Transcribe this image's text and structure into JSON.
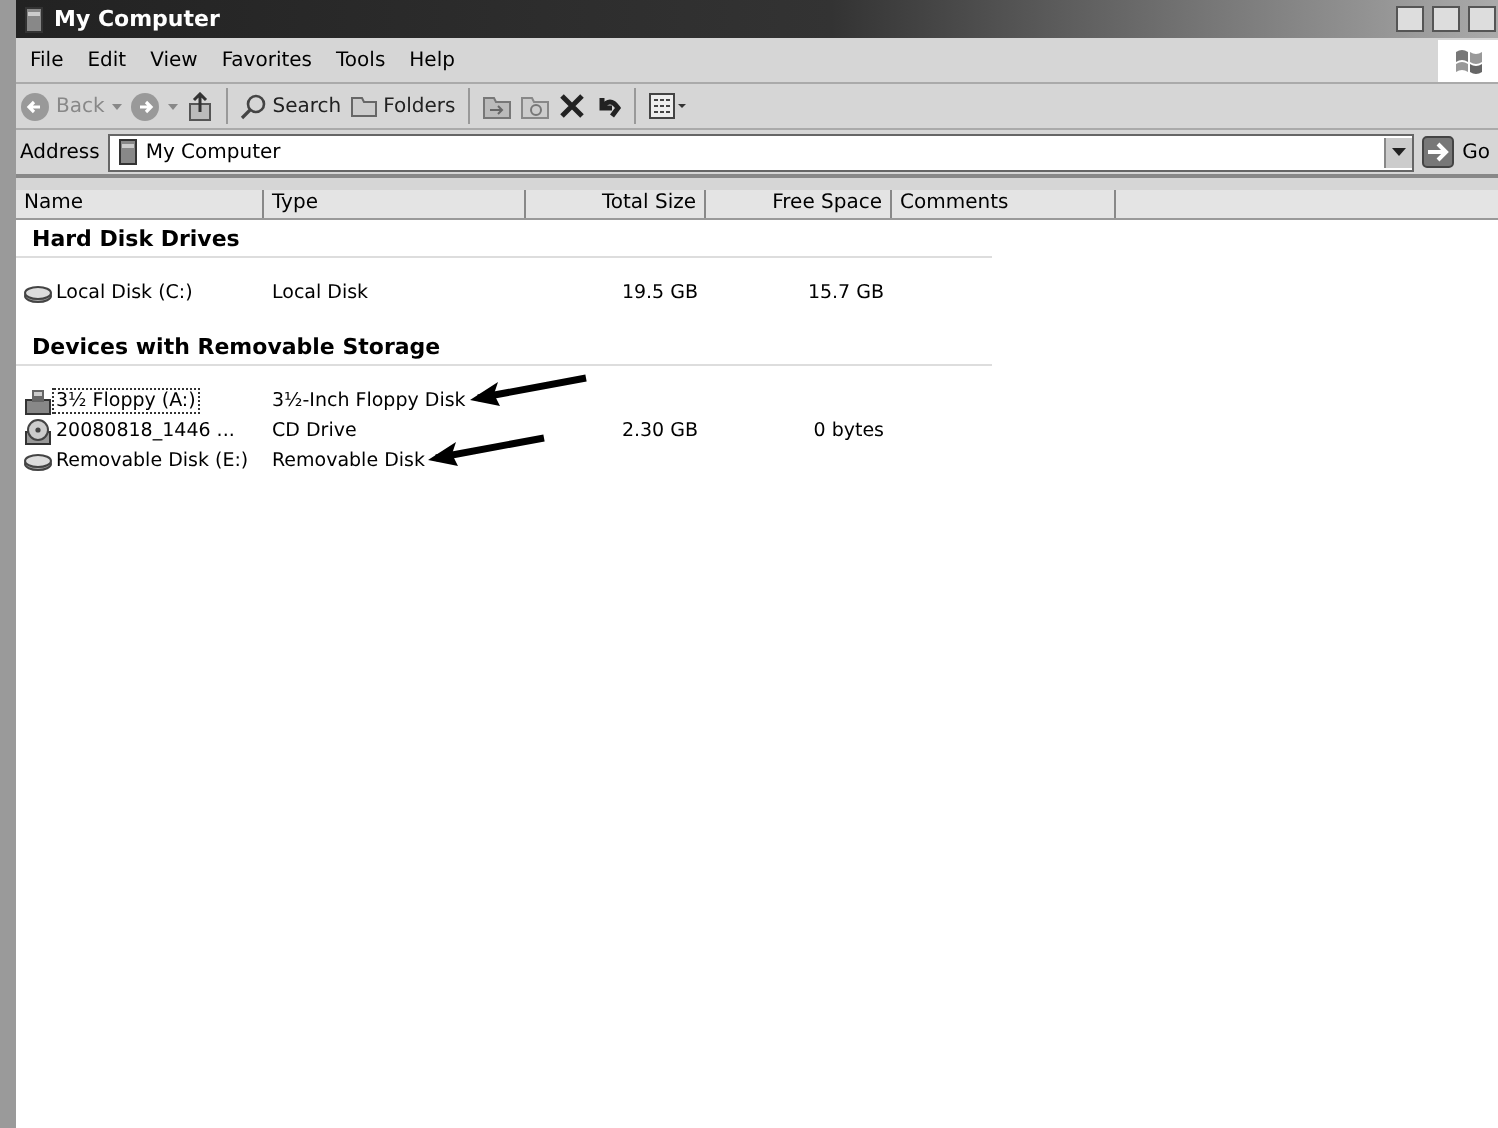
{
  "window": {
    "title": "My Computer"
  },
  "menu": [
    "File",
    "Edit",
    "View",
    "Favorites",
    "Tools",
    "Help"
  ],
  "toolbar": {
    "back": "Back",
    "search": "Search",
    "folders": "Folders"
  },
  "address": {
    "label": "Address",
    "value": "My Computer",
    "go": "Go"
  },
  "table": {
    "columns": [
      "Name",
      "Type",
      "Total Size",
      "Free Space",
      "Comments"
    ],
    "groups": [
      {
        "title": "Hard Disk Drives",
        "rows": [
          {
            "kind": "harddisk",
            "name": "Local Disk (C:)",
            "type": "Local Disk",
            "total": "19.5 GB",
            "free": "15.7 GB",
            "focused": false,
            "arrow": false
          }
        ]
      },
      {
        "title": "Devices with Removable Storage",
        "rows": [
          {
            "kind": "floppy",
            "name": "3½ Floppy (A:)",
            "type": "3½-Inch Floppy Disk",
            "focused": true,
            "arrow": true
          },
          {
            "kind": "cd",
            "name": "20080818_1446 ...",
            "type": "CD Drive",
            "total": "2.30 GB",
            "free": "0 bytes",
            "focused": false,
            "arrow": false
          },
          {
            "kind": "harddisk",
            "name": "Removable Disk (E:)",
            "type": "Removable Disk",
            "focused": false,
            "arrow": true
          }
        ]
      }
    ]
  }
}
